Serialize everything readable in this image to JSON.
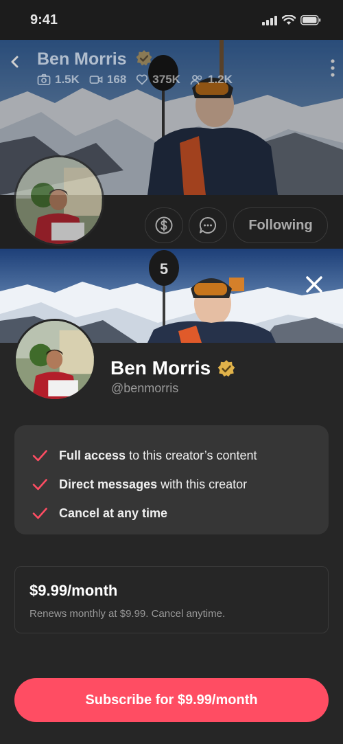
{
  "status_bar": {
    "time": "9:41"
  },
  "profile": {
    "name": "Ben Morris",
    "stats": [
      {
        "icon": "camera-icon",
        "value": "1.5K"
      },
      {
        "icon": "video-icon",
        "value": "168"
      },
      {
        "icon": "heart-icon",
        "value": "375K"
      },
      {
        "icon": "users-icon",
        "value": "1.2K"
      }
    ],
    "following_label": "Following"
  },
  "sheet": {
    "name": "Ben Morris",
    "handle": "@benmorris",
    "benefits": [
      {
        "bold": "Full access",
        "rest": "to this creator’s content"
      },
      {
        "bold": "Direct messages",
        "rest": "with this creator"
      },
      {
        "bold": "Cancel at any time",
        "rest": ""
      }
    ],
    "price": "$9.99/month",
    "price_note": "Renews monthly at $9.99. Cancel anytime.",
    "subscribe_label": "Subscribe for $9.99/month"
  },
  "colors": {
    "accent": "#ff4d63",
    "verified": "#e0b24a",
    "background": "#262626",
    "card": "#363636"
  }
}
